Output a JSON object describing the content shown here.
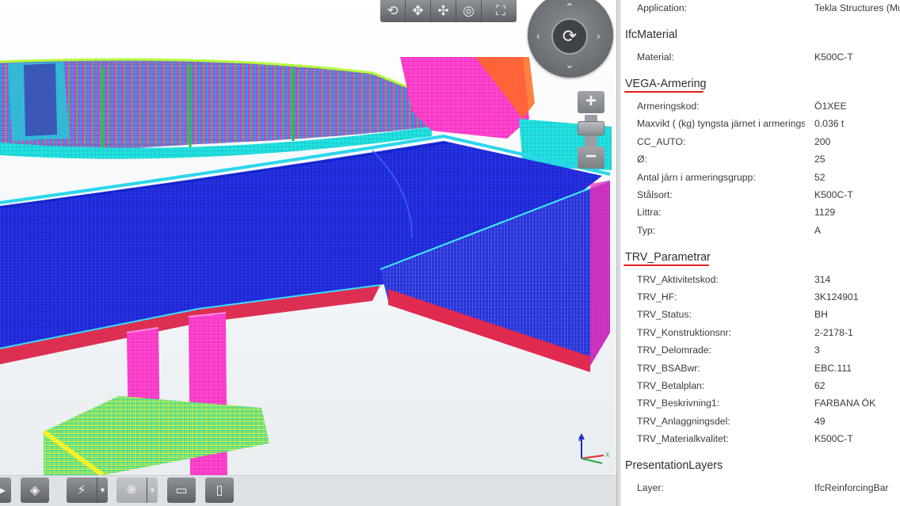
{
  "panel": {
    "top_row": {
      "key": "Application:",
      "value": "Tekla Structures (Mu"
    },
    "sections": [
      {
        "title": "IfcMaterial",
        "rows": [
          {
            "key": "Material:",
            "value": "K500C-T"
          }
        ]
      },
      {
        "title": "VEGA-Armering",
        "rows": [
          {
            "key": "Armeringskod:",
            "value": "Ö1XEE"
          },
          {
            "key": "Maxvikt ( (kg) tyngsta järnet i armeringsgrupp",
            "value": "0.036 t"
          },
          {
            "key": "CC_AUTO:",
            "value": "200"
          },
          {
            "key": "Ø:",
            "value": "25"
          },
          {
            "key": "Antal järn i armeringsgrupp:",
            "value": "52"
          },
          {
            "key": "Stålsort:",
            "value": "K500C-T"
          },
          {
            "key": "Littra:",
            "value": "1129"
          },
          {
            "key": "Typ:",
            "value": "A"
          }
        ]
      },
      {
        "title": "TRV_Parametrar",
        "rows": [
          {
            "key": "TRV_Aktivitetskod:",
            "value": "314"
          },
          {
            "key": "TRV_HF:",
            "value": "3K124901"
          },
          {
            "key": "TRV_Status:",
            "value": "BH"
          },
          {
            "key": "TRV_Konstruktionsnr:",
            "value": "2-2178-1"
          },
          {
            "key": "TRV_Delomrade:",
            "value": "3"
          },
          {
            "key": "TRV_BSABwr:",
            "value": "EBC.111"
          },
          {
            "key": "TRV_Betalplan:",
            "value": "62"
          },
          {
            "key": "TRV_Beskrivning1:",
            "value": "FARBANA ÖK"
          },
          {
            "key": "TRV_Anlaggningsdel:",
            "value": "49"
          },
          {
            "key": "TRV_Materialkvalitet:",
            "value": "K500C-T"
          }
        ]
      },
      {
        "title": "PresentationLayers",
        "rows": [
          {
            "key": "Layer:",
            "value": "IfcReinforcingBar"
          }
        ]
      }
    ]
  },
  "annotations": {
    "underline_color": "#e0211d"
  },
  "icons": {
    "top_toolbar": [
      "orbit-icon",
      "pan-icon",
      "walk-icon",
      "look-around-icon",
      "fit-view-icon"
    ],
    "nav_wheel": [
      "rotate-icon",
      "arrow-up-icon",
      "arrow-down-icon",
      "arrow-left-icon",
      "arrow-right-icon"
    ],
    "zoom": [
      "zoom-in-icon",
      "zoom-out-icon"
    ],
    "bottom_toolbar": [
      "play-icon",
      "view-cube-icon",
      "lightning-icon",
      "filter-icon",
      "comment-icon",
      "document-icon"
    ]
  }
}
